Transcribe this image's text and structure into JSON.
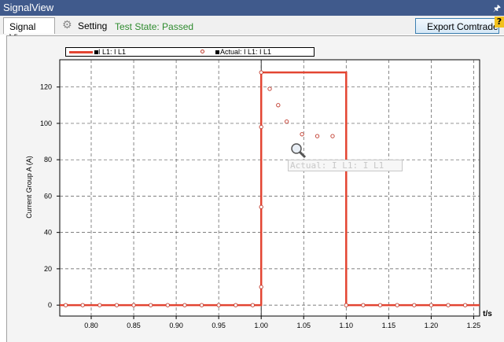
{
  "window": {
    "title": "SignalView",
    "pin_icon": "pin-icon"
  },
  "tabs": [
    {
      "label": "Signal View",
      "active": true
    },
    {
      "label": "Setting",
      "icon": "gear-icon",
      "active": false
    }
  ],
  "test_state": "Test State: Passed",
  "toolbar": {
    "export_label": "Export Comtrade ...",
    "help_badge": "?"
  },
  "legend": {
    "series1_label": "I L1: I L1",
    "series2_label": "Actual: I L1: I L1"
  },
  "tooltip": "Actual: I L1: I L1",
  "colors": {
    "titlebar": "#405a8c",
    "series": "#e34532",
    "marker": "#c0392b",
    "status": "#2e8b2e"
  },
  "chart_data": {
    "type": "line",
    "ylabel": "Current Group A (A)",
    "xlabel": "t/s",
    "xlim": [
      0.763,
      1.257
    ],
    "ylim": [
      -6,
      135
    ],
    "x_ticks": [
      "0.80",
      "0.85",
      "0.90",
      "0.95",
      "1.00",
      "1.05",
      "1.10",
      "1.15",
      "1.20",
      "1.25"
    ],
    "y_ticks": [
      "0",
      "20",
      "40",
      "60",
      "80",
      "100",
      "120"
    ],
    "grid": true,
    "series": [
      {
        "name": "I L1: I L1",
        "style": "line",
        "x": [
          0.763,
          1.0,
          1.0,
          1.1,
          1.1,
          1.257
        ],
        "values": [
          0,
          0,
          128,
          128,
          0,
          0
        ]
      },
      {
        "name": "Actual: I L1: I L1",
        "style": "markers",
        "x": [
          0.77,
          0.79,
          0.81,
          0.83,
          0.85,
          0.87,
          0.89,
          0.91,
          0.93,
          0.95,
          0.97,
          0.99,
          1.0,
          1.0,
          1.0,
          1.0,
          1.01,
          1.02,
          1.03,
          1.048,
          1.066,
          1.084,
          1.1,
          1.12,
          1.14,
          1.16,
          1.18,
          1.2,
          1.22,
          1.24
        ],
        "values": [
          0,
          0,
          0,
          0,
          0,
          0,
          0,
          0,
          0,
          0,
          0,
          0,
          10,
          54,
          98,
          128,
          119,
          110,
          101,
          94,
          93,
          93,
          0,
          0,
          0,
          0,
          0,
          0,
          0,
          0
        ]
      }
    ]
  }
}
